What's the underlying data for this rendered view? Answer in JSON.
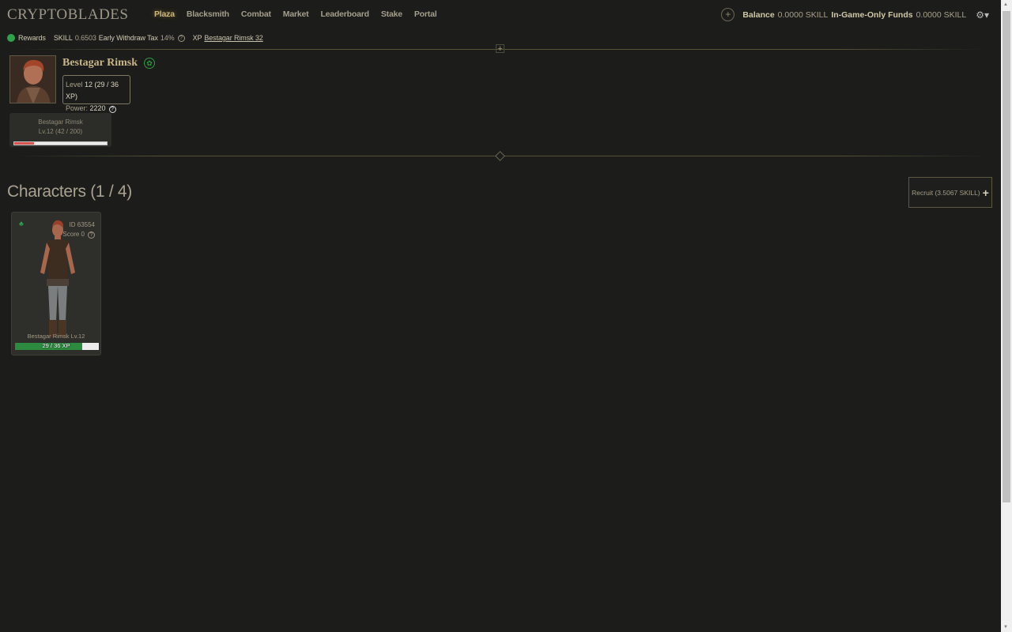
{
  "logo": "CRYPTOBLADES",
  "nav": [
    "Plaza",
    "Blacksmith",
    "Combat",
    "Market",
    "Leaderboard",
    "Stake",
    "Portal"
  ],
  "balance": {
    "label": "Balance",
    "value": "0.0000 SKILL",
    "funds_label": "In-Game-Only Funds",
    "funds_value": "0.0000 SKILL"
  },
  "rewards": {
    "label": "Rewards",
    "skill_label": "SKILL",
    "skill_value": "0.6503",
    "tax_label": "Early Withdraw Tax",
    "tax_value": "14%",
    "xp_label": "XP",
    "xp_value": "Bestagar Rimsk 32"
  },
  "character": {
    "name": "Bestagar Rimsk",
    "level_label": "Level",
    "level_value": "12 (29 / 36 XP)",
    "power_label": "Power:",
    "power_value": "2220",
    "mini_name": "Bestagar Rimsk",
    "mini_level": "Lv.12 (42 / 200)",
    "stamina_fraction": 0.21
  },
  "characters_section": {
    "title": "Characters (1 / 4)",
    "recruit_label": "Recruit (3.5067 SKILL)",
    "cards": [
      {
        "id": "ID 63554",
        "score": "Score 0",
        "label": "Bestagar Rimsk Lv.12",
        "xp_text": "29 / 36 XP",
        "xp_fraction": 0.8
      }
    ]
  },
  "colors": {
    "background": "#1c1c1a",
    "accent": "#c9b77d",
    "element_green": "#2e9b3f",
    "stamina_red": "#d9534f"
  }
}
